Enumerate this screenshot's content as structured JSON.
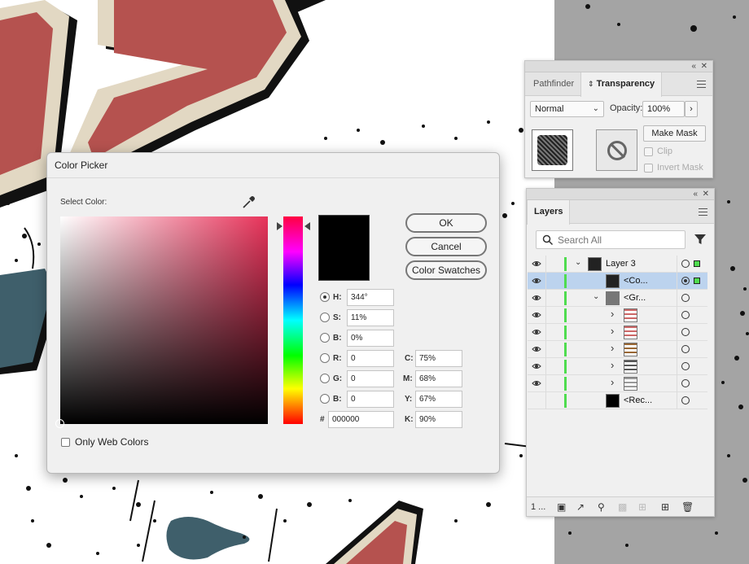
{
  "transparency_panel": {
    "tabs": [
      "Pathfinder",
      "Transparency"
    ],
    "blend_mode": "Normal",
    "opacity_label": "Opacity:",
    "opacity_value": "100%",
    "make_mask_label": "Make Mask",
    "clip_label": "Clip",
    "invert_mask_label": "Invert Mask"
  },
  "layers_panel": {
    "tab": "Layers",
    "search_placeholder": "Search All",
    "rows": [
      {
        "name": "Layer 3",
        "indent": 0,
        "expanded": true,
        "selected": false
      },
      {
        "name": "<Co...",
        "indent": 1,
        "expanded": null,
        "selected": true
      },
      {
        "name": "<Gr...",
        "indent": 1,
        "expanded": true,
        "selected": false
      },
      {
        "name": "",
        "indent": 2,
        "expanded": false,
        "selected": false
      },
      {
        "name": "",
        "indent": 2,
        "expanded": false,
        "selected": false
      },
      {
        "name": "",
        "indent": 2,
        "expanded": false,
        "selected": false
      },
      {
        "name": "",
        "indent": 2,
        "expanded": false,
        "selected": false
      },
      {
        "name": "",
        "indent": 2,
        "expanded": false,
        "selected": false
      },
      {
        "name": "<Rec...",
        "indent": 1,
        "expanded": null,
        "selected": false
      }
    ],
    "footer_count": "1 ..."
  },
  "color_picker": {
    "title": "Color Picker",
    "select_color_label": "Select Color:",
    "ok_label": "OK",
    "cancel_label": "Cancel",
    "swatches_label": "Color Swatches",
    "h_label": "H:",
    "h_value": "344°",
    "s_label": "S:",
    "s_value": "11%",
    "b_label": "B:",
    "b_value": "0%",
    "r_label": "R:",
    "r_value": "0",
    "g_label": "G:",
    "g_value": "0",
    "bl_label": "B:",
    "bl_value": "0",
    "hex_label": "#",
    "hex_value": "000000",
    "c_label": "C:",
    "c_value": "75%",
    "m_label": "M:",
    "m_value": "68%",
    "y_label": "Y:",
    "y_value": "67%",
    "k_label": "K:",
    "k_value": "90%",
    "web_colors_label": "Only Web Colors",
    "current_color": "#000000"
  },
  "colors": {
    "artwork_red": "#b5524f",
    "artwork_cream": "#e2d8c3",
    "artwork_teal": "#3f5f6b",
    "pasteboard": "#a4a4a4",
    "selection": "#bcd3ee",
    "layer_color": "#4fdc4f"
  }
}
